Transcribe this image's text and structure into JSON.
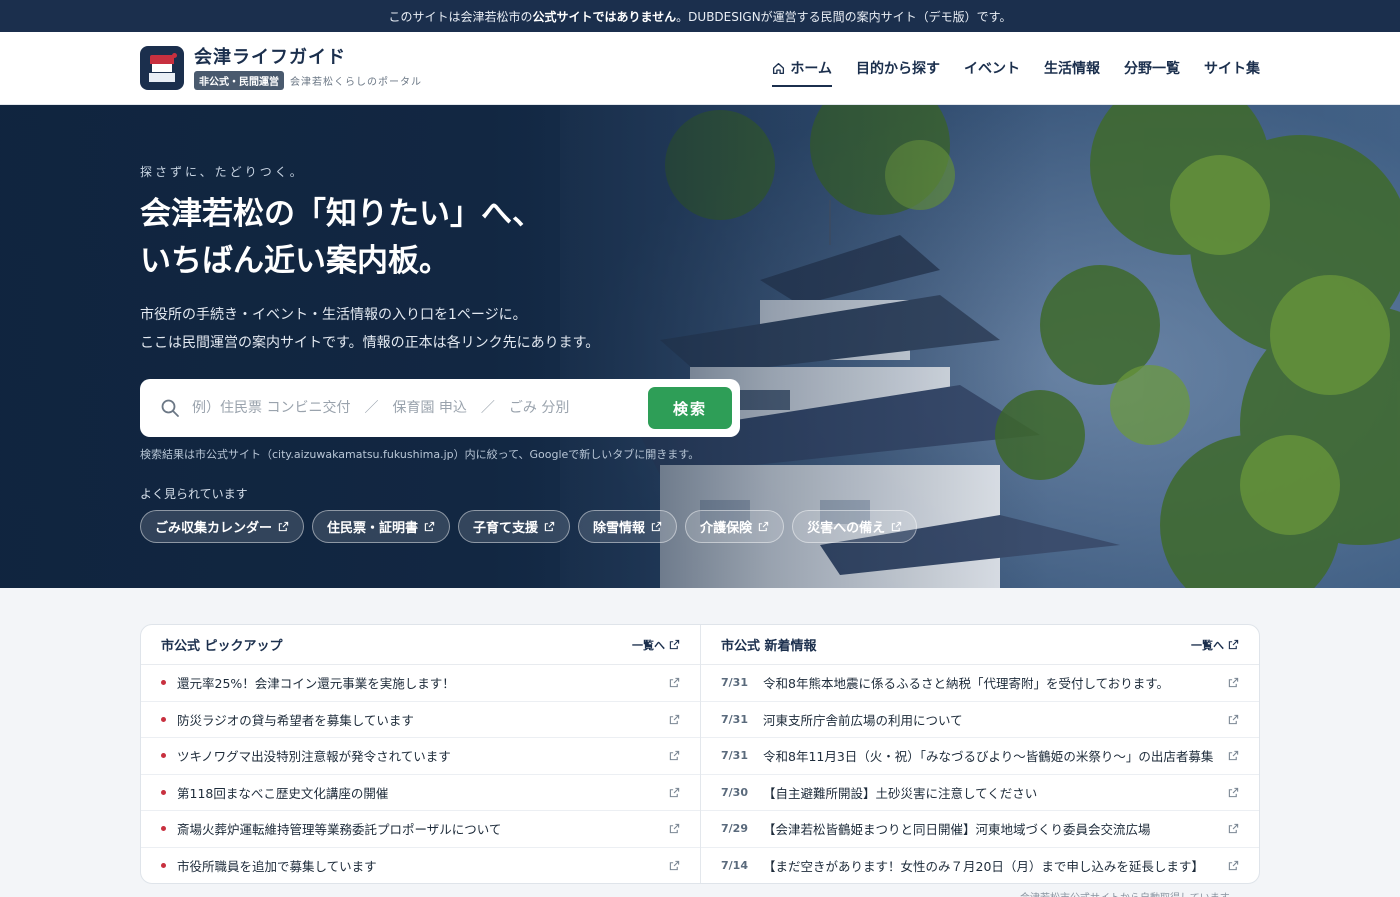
{
  "notice": {
    "pre": "このサイトは会津若松市の",
    "bold": "公式サイトではありません",
    "post": "。DUBDESIGNが運営する民間の案内サイト（デモ版）です。"
  },
  "brand": {
    "title": "会津ライフガイド",
    "badge": "非公式・民間運営",
    "tagline": "会津若松くらしのポータル"
  },
  "nav": [
    {
      "label": "ホーム",
      "icon": "home-icon",
      "active": true
    },
    {
      "label": "目的から探す"
    },
    {
      "label": "イベント"
    },
    {
      "label": "生活情報"
    },
    {
      "label": "分野一覧"
    },
    {
      "label": "サイト集"
    }
  ],
  "hero": {
    "eyebrow": "探さずに、たどりつく。",
    "title_line1": "会津若松の「知りたい」へ、",
    "title_line2": "いちばん近い案内板。",
    "desc_line1": "市役所の手続き・イベント・生活情報の入り口を1ページに。",
    "desc_line2": "ここは民間運営の案内サイトです。情報の正本は各リンク先にあります。",
    "search_placeholder": "例）住民票 コンビニ交付　／　保育園 申込　／　ごみ 分別",
    "search_value": "",
    "search_button": "検索",
    "search_note": "検索結果は市公式サイト（city.aizuwakamatsu.fukushima.jp）内に絞って、Googleで新しいタブに開きます。",
    "popular_label": "よく見られています",
    "chips": [
      "ごみ収集カレンダー",
      "住民票・証明書",
      "子育て支援",
      "除雪情報",
      "介護保険",
      "災害への備え"
    ]
  },
  "pickup": {
    "title": "市公式 ピックアップ",
    "more": "一覧へ",
    "items": [
      "還元率25%！会津コイン還元事業を実施します！",
      "防災ラジオの貸与希望者を募集しています",
      "ツキノワグマ出没特別注意報が発令されています",
      "第118回まなべこ歴史文化講座の開催",
      "斎場火葬炉運転維持管理等業務委託プロポーザルについて",
      "市役所職員を追加で募集しています"
    ]
  },
  "news": {
    "title": "市公式 新着情報",
    "more": "一覧へ",
    "items": [
      {
        "date": "7/31",
        "text": "令和8年熊本地震に係るふるさと納税「代理寄附」を受付しております。"
      },
      {
        "date": "7/31",
        "text": "河東支所庁舎前広場の利用について"
      },
      {
        "date": "7/31",
        "text": "令和8年11月3日（火・祝）「みなづるびより～皆鶴姫の米祭り～」の出店者募集"
      },
      {
        "date": "7/30",
        "text": "【自主避難所開設】土砂災害に注意してください"
      },
      {
        "date": "7/29",
        "text": "【会津若松皆鶴姫まつりと同日開催】河東地域づくり委員会交流広場"
      },
      {
        "date": "7/14",
        "text": "【まだ空きがあります！女性のみ７月20日（月）まで申し込みを延長します】"
      }
    ]
  },
  "footnote": "会津若松市公式サイトから自動取得しています",
  "colors": {
    "navy": "#1b2f4d",
    "accent_red": "#c8303f",
    "search_green": "#2e9e57"
  }
}
